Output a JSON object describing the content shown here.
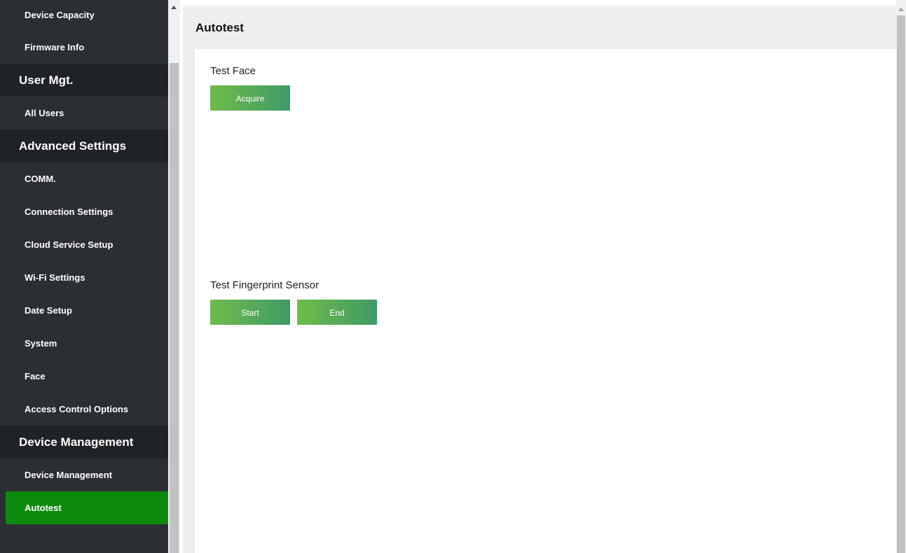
{
  "sidebar": {
    "items": [
      {
        "type": "item",
        "label": "Device Capacity"
      },
      {
        "type": "item",
        "label": "Firmware Info"
      },
      {
        "type": "head",
        "label": "User Mgt."
      },
      {
        "type": "item",
        "label": "All Users"
      },
      {
        "type": "head",
        "label": "Advanced Settings"
      },
      {
        "type": "item",
        "label": "COMM."
      },
      {
        "type": "item",
        "label": "Connection Settings"
      },
      {
        "type": "item",
        "label": "Cloud Service Setup"
      },
      {
        "type": "item",
        "label": "Wi-Fi Settings"
      },
      {
        "type": "item",
        "label": "Date Setup"
      },
      {
        "type": "item",
        "label": "System"
      },
      {
        "type": "item",
        "label": "Face"
      },
      {
        "type": "item",
        "label": "Access Control Options"
      },
      {
        "type": "head",
        "label": "Device Management"
      },
      {
        "type": "item",
        "label": "Device Management"
      },
      {
        "type": "item",
        "label": "Autotest",
        "active": true
      }
    ]
  },
  "main": {
    "title": "Autotest",
    "test_face": {
      "label": "Test Face",
      "acquire_label": "Acquire"
    },
    "test_fingerprint": {
      "label": "Test Fingerprint Sensor",
      "start_label": "Start",
      "end_label": "End"
    }
  },
  "colors": {
    "sidebar_bg": "#2b2f33",
    "sidebar_head_bg": "#1f2226",
    "active_bg": "#0b8a0b",
    "button_gradient_start": "#6fbc4a",
    "button_gradient_end": "#3f9a68"
  }
}
